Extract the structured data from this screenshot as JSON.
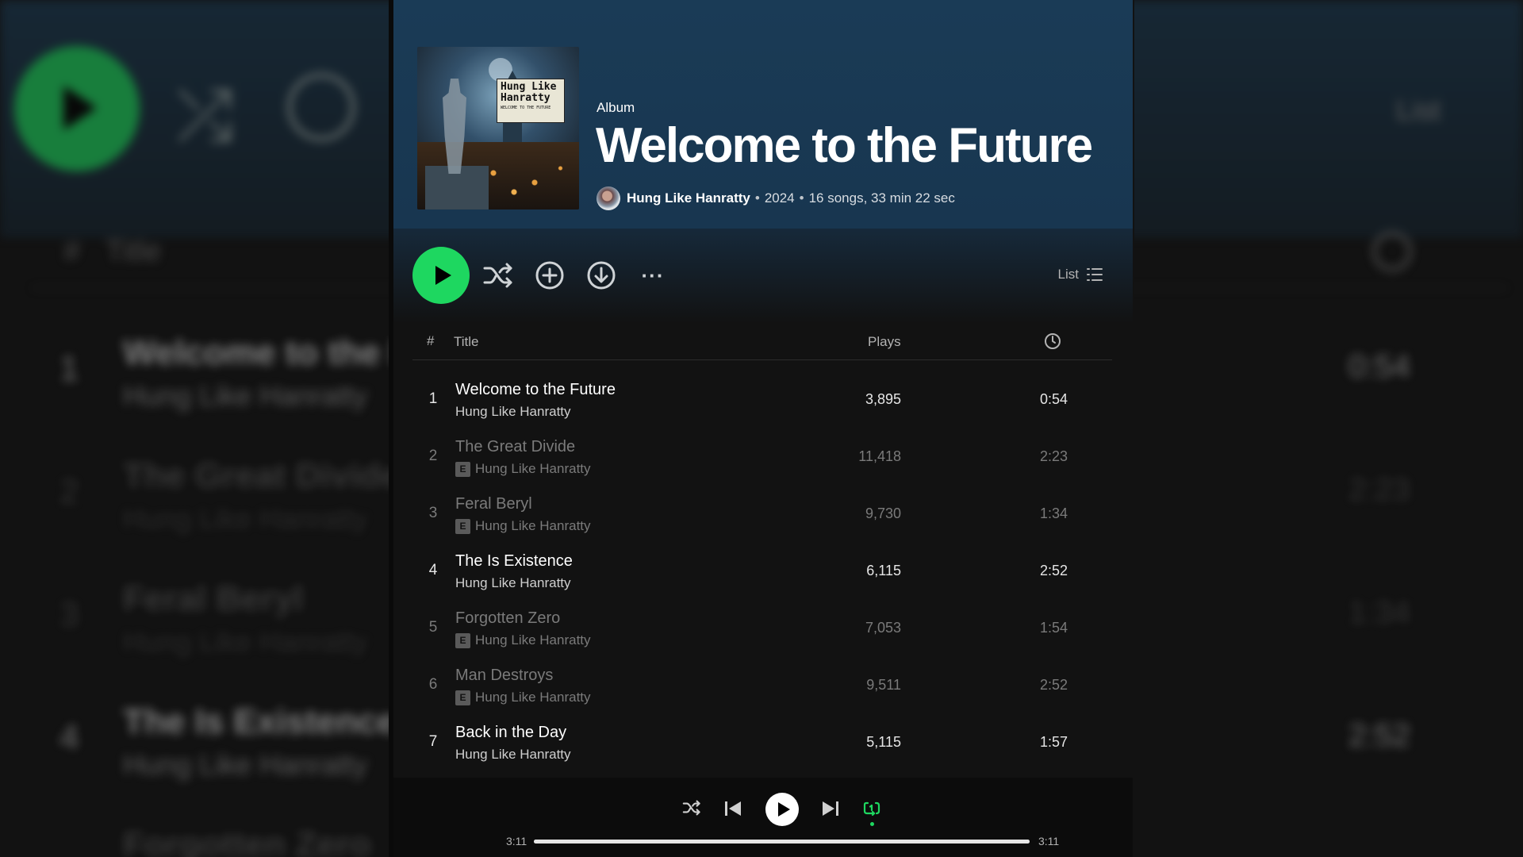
{
  "album": {
    "type_label": "Album",
    "title": "Welcome to the Future",
    "artist": "Hung Like Hanratty",
    "year": "2024",
    "summary": "16 songs, 33 min 22 sec",
    "cover_text_line1": "Hung Like",
    "cover_text_line2": "Hanratty",
    "cover_text_sub": "WELCOME TO THE FUTURE",
    "separator": "•"
  },
  "controls": {
    "view_label": "List",
    "more_label": "···"
  },
  "table": {
    "col_num": "#",
    "col_title": "Title",
    "col_plays": "Plays"
  },
  "tracks": [
    {
      "num": "1",
      "title": "Welcome to the Future",
      "artist": "Hung Like Hanratty",
      "explicit": false,
      "plays": "3,895",
      "duration": "0:54"
    },
    {
      "num": "2",
      "title": "The Great Divide",
      "artist": "Hung Like Hanratty",
      "explicit": true,
      "plays": "11,418",
      "duration": "2:23"
    },
    {
      "num": "3",
      "title": "Feral Beryl",
      "artist": "Hung Like Hanratty",
      "explicit": true,
      "plays": "9,730",
      "duration": "1:34"
    },
    {
      "num": "4",
      "title": "The Is Existence",
      "artist": "Hung Like Hanratty",
      "explicit": false,
      "plays": "6,115",
      "duration": "2:52"
    },
    {
      "num": "5",
      "title": "Forgotten Zero",
      "artist": "Hung Like Hanratty",
      "explicit": true,
      "plays": "7,053",
      "duration": "1:54"
    },
    {
      "num": "6",
      "title": "Man Destroys",
      "artist": "Hung Like Hanratty",
      "explicit": true,
      "plays": "9,511",
      "duration": "2:52"
    },
    {
      "num": "7",
      "title": "Back in the Day",
      "artist": "Hung Like Hanratty",
      "explicit": false,
      "plays": "5,115",
      "duration": "1:57"
    }
  ],
  "explicit_badge": "E",
  "player": {
    "elapsed": "3:11",
    "total": "3:11",
    "progress": 1.0
  },
  "colors": {
    "accent": "#1ed760",
    "header_bg": "#1a3b56",
    "surface": "#121212"
  }
}
